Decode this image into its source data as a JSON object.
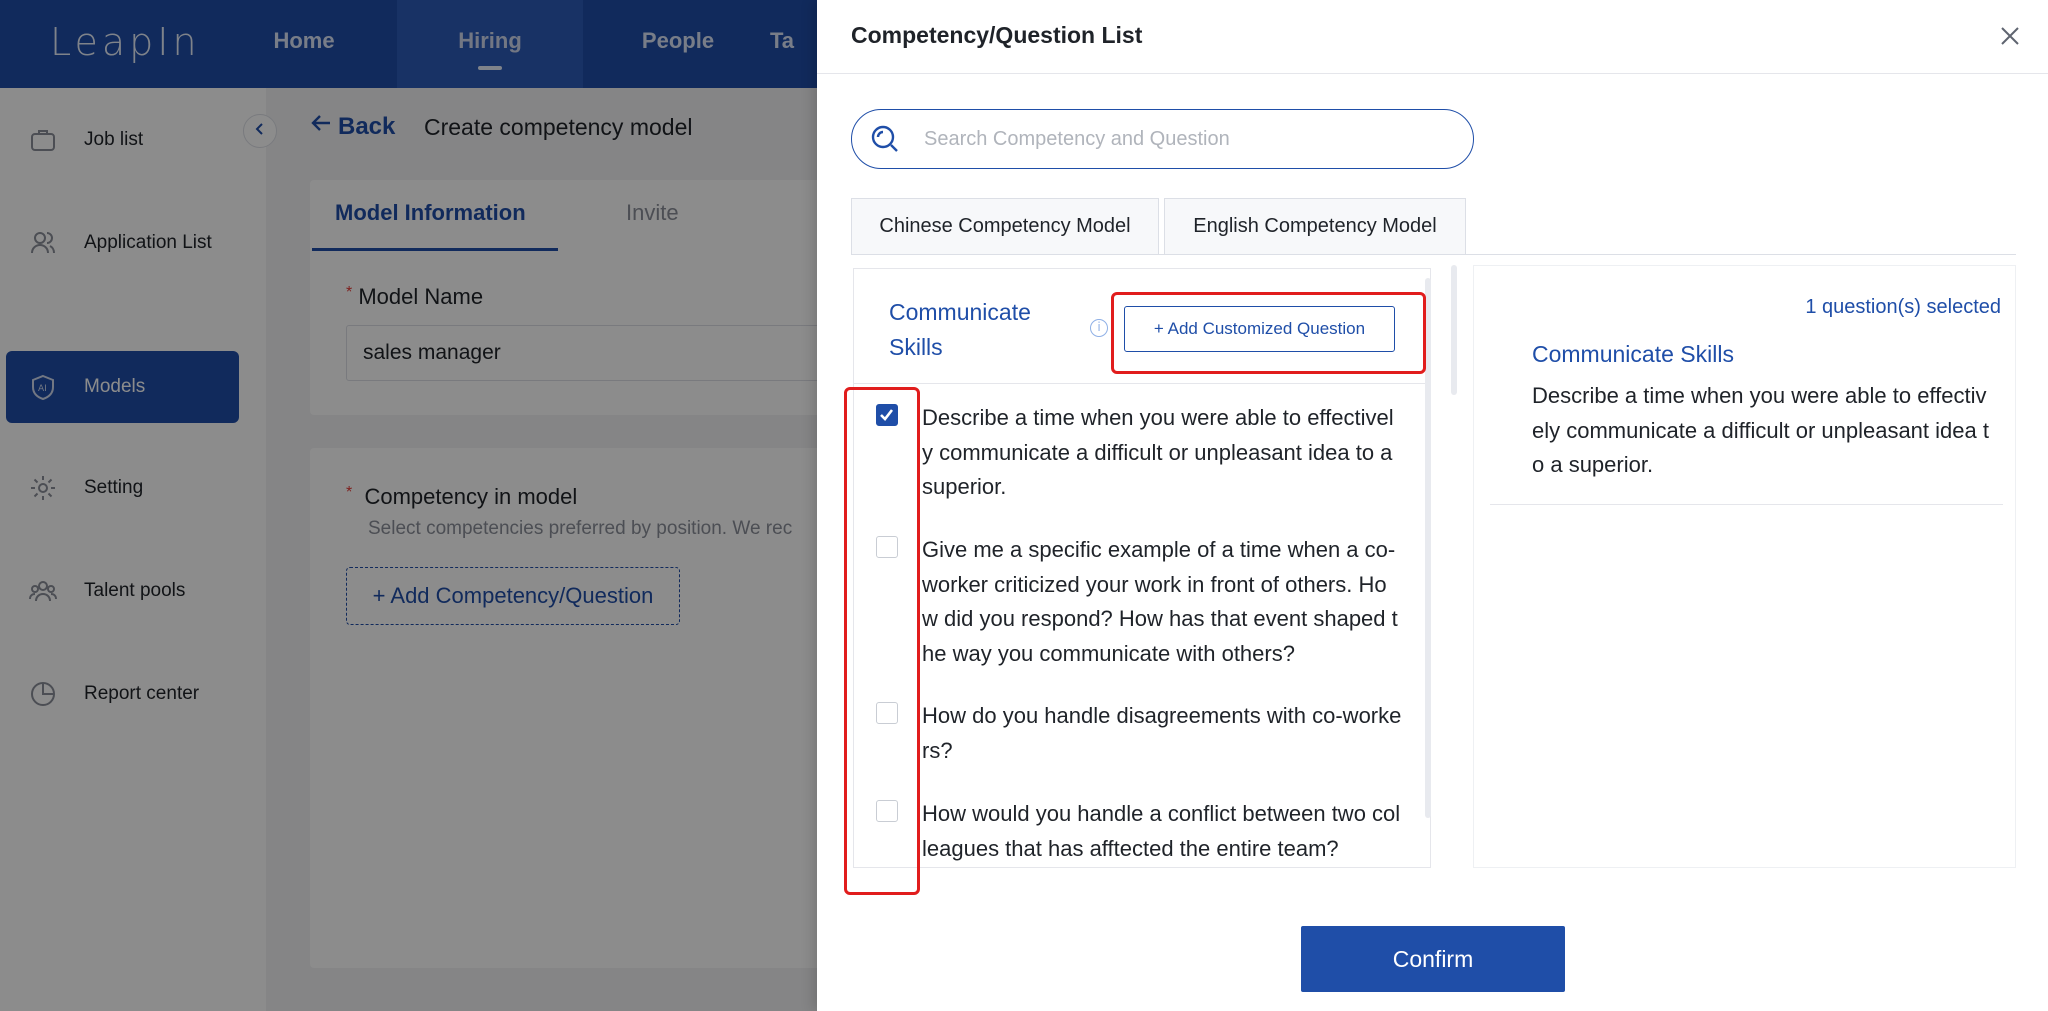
{
  "app": {
    "logo": "LeapIn",
    "nav": [
      "Home",
      "Hiring",
      "People",
      "Ta"
    ],
    "active_nav": "Hiring"
  },
  "sidebar": {
    "items": [
      {
        "label": "Job list",
        "icon": "briefcase-icon"
      },
      {
        "label": "Application List",
        "icon": "users-icon"
      },
      {
        "label": "Models",
        "icon": "ai-shield-icon"
      },
      {
        "label": "Setting",
        "icon": "gear-icon"
      },
      {
        "label": "Talent pools",
        "icon": "group-icon"
      },
      {
        "label": "Report center",
        "icon": "pie-chart-icon"
      }
    ],
    "active": "Models"
  },
  "main": {
    "back_label": "Back",
    "page_title": "Create competency model",
    "tabs": [
      "Model Information",
      "Invite"
    ],
    "model_name_label": "Model Name",
    "model_name_value": "sales manager",
    "competency_label": "Competency in model",
    "competency_hint": "Select competencies preferred by position. We rec",
    "add_competency_label": "+ Add Competency/Question"
  },
  "drawer": {
    "title": "Competency/Question List",
    "search_placeholder": "Search Competency and Question",
    "tabs": [
      "Chinese Competency Model",
      "English Competency Model"
    ],
    "competency": {
      "name": "Communicate Skills",
      "add_custom_label": "+ Add Customized Question",
      "questions": [
        {
          "text": "Describe a time when you were able to effectively communicate a difficult or unpleasant idea to a superior.",
          "checked": true
        },
        {
          "text": "Give me a specific example of a time when a co-worker criticized your work in front of others. How did you respond? How has that event shaped the way you communicate with others?",
          "checked": false
        },
        {
          "text": "How do you handle disagreements with co-workers?",
          "checked": false
        },
        {
          "text": "How would you handle a conflict between two colleagues that has afftected the entire team?",
          "checked": false
        }
      ]
    },
    "selected": {
      "count_label": "1 question(s) selected",
      "competency": "Communicate Skills",
      "question": "Describe a time when you were able to effectively communicate a difficult or unpleasant idea to a superior."
    },
    "confirm_label": "Confirm"
  },
  "colors": {
    "brand": "#1f4ea8",
    "highlight": "#e11d1d"
  }
}
